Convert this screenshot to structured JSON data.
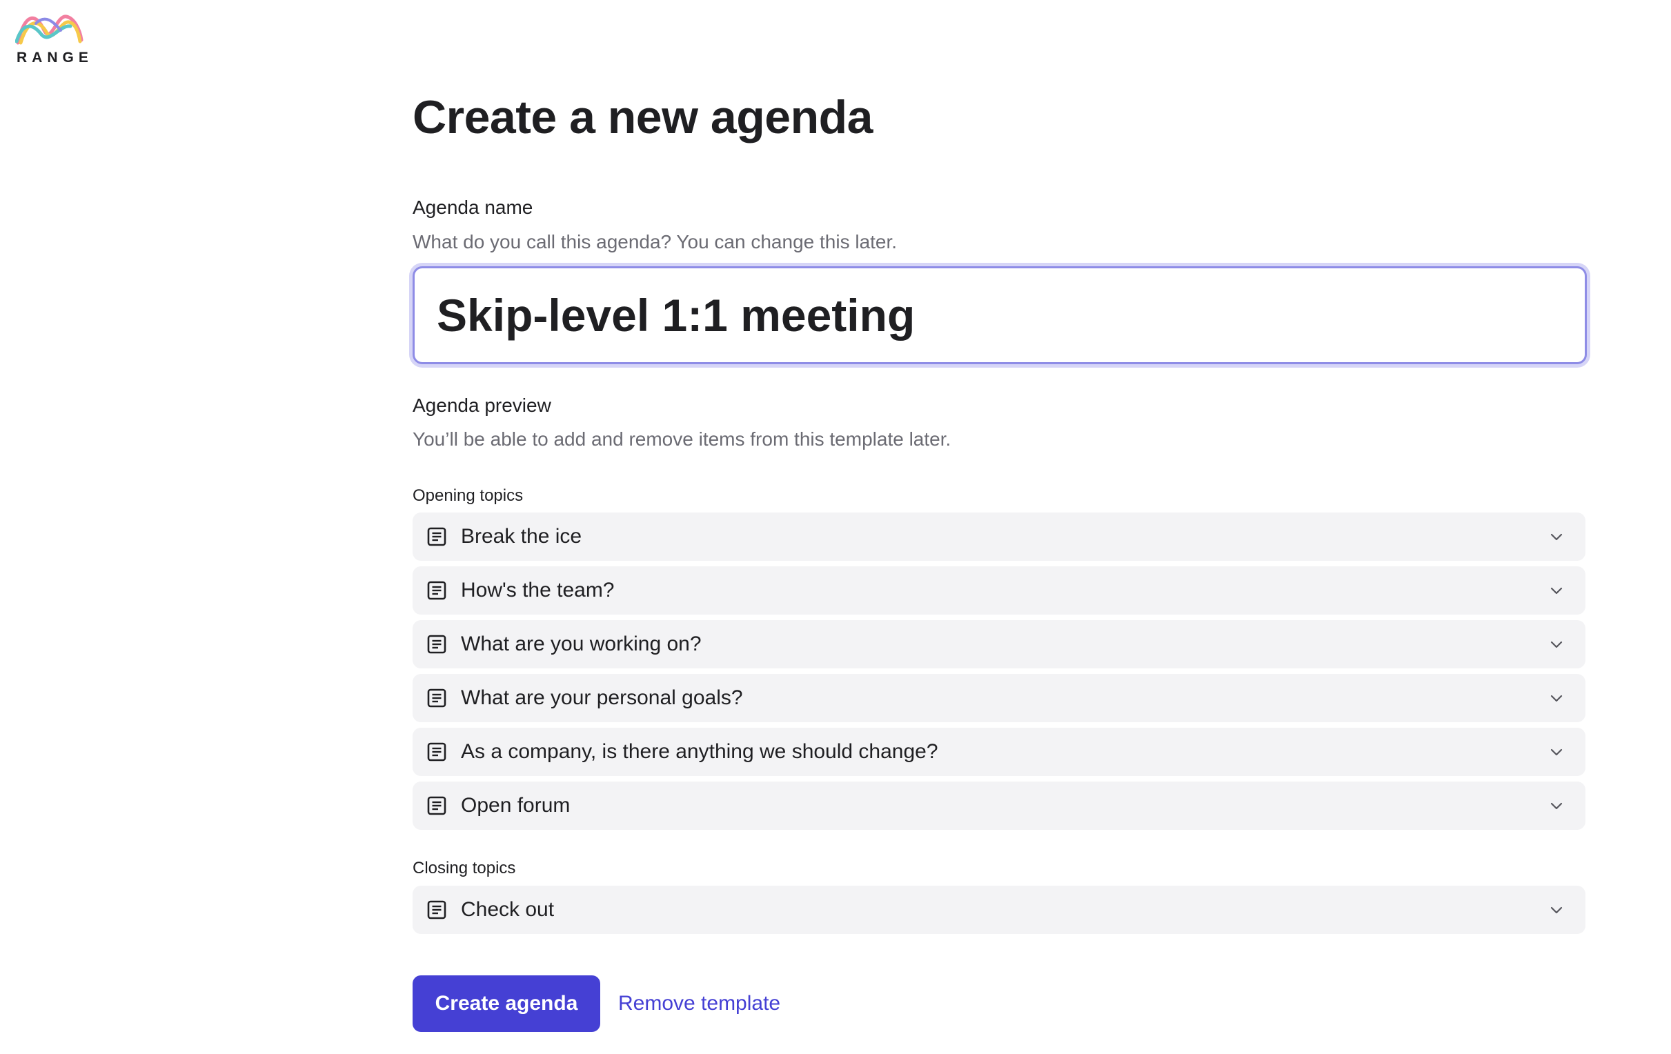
{
  "brand": {
    "name": "RANGE",
    "logo_colors": [
      "#f27fa0",
      "#f6c94a",
      "#5ac6c8",
      "#8b8ae6"
    ]
  },
  "page": {
    "title": "Create a new agenda"
  },
  "agenda_name": {
    "label": "Agenda name",
    "help": "What do you call this agenda? You can change this later.",
    "value": "Skip-level 1:1 meeting"
  },
  "agenda_preview": {
    "label": "Agenda preview",
    "help": "You’ll be able to add and remove items from this template later."
  },
  "opening_topics": {
    "label": "Opening topics",
    "items": [
      {
        "title": "Break the ice",
        "icon": "document-icon"
      },
      {
        "title": "How's the team?",
        "icon": "document-icon"
      },
      {
        "title": "What are you working on?",
        "icon": "document-icon"
      },
      {
        "title": "What are your personal goals?",
        "icon": "document-icon"
      },
      {
        "title": "As a company, is there anything we should change?",
        "icon": "document-icon"
      },
      {
        "title": "Open forum",
        "icon": "document-icon"
      }
    ]
  },
  "closing_topics": {
    "label": "Closing topics",
    "items": [
      {
        "title": "Check out",
        "icon": "document-icon"
      }
    ]
  },
  "actions": {
    "create_label": "Create agenda",
    "remove_label": "Remove template",
    "accent_color": "#4540d4"
  }
}
